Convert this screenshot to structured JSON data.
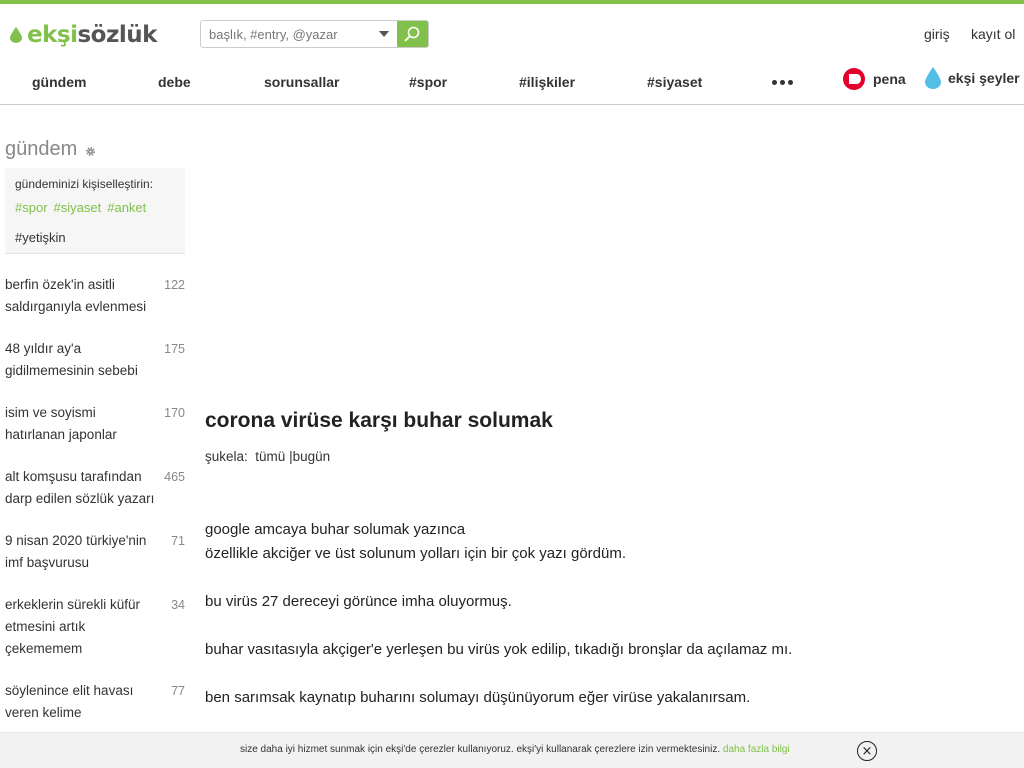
{
  "brand": {
    "logo_part1": "ekşi",
    "logo_part2": "sözlük",
    "accent_color": "#81c14b"
  },
  "search": {
    "placeholder": "başlık, #entry, @yazar"
  },
  "auth": {
    "login": "giriş",
    "register": "kayıt ol"
  },
  "nav": {
    "items": [
      "gündem",
      "debe",
      "sorunsallar",
      "#spor",
      "#ilişkiler",
      "#siyaset"
    ],
    "more_icon": "ellipsis-icon",
    "pena": "pena",
    "seyler": "ekşi şeyler"
  },
  "sidebar": {
    "title": "gündem",
    "personalize": {
      "title": "gündeminizi kişiselleştirin:",
      "tags": [
        "#spor",
        "#siyaset",
        "#anket"
      ],
      "adult": "#yetişkin"
    },
    "topics": [
      {
        "title": "berfin özek'in asitli saldırganıyla evlenmesi",
        "count": "122"
      },
      {
        "title": "48 yıldır ay'a gidilmemesinin sebebi",
        "count": "175"
      },
      {
        "title": "isim ve soyismi hatırlanan japonlar",
        "count": "170"
      },
      {
        "title": "alt komşusu tarafından darp edilen sözlük yazarı",
        "count": "465"
      },
      {
        "title": "9 nisan 2020 türkiye'nin imf başvurusu",
        "count": "71"
      },
      {
        "title": "erkeklerin sürekli küfür etmesini artık çekememem",
        "count": "34"
      },
      {
        "title": "söylenince elit havası veren kelime",
        "count": "77"
      }
    ]
  },
  "entry": {
    "title": "corona virüse karşı buhar solumak",
    "sukela_label": "şukela:",
    "sukela_all": "tümü",
    "sukela_sep": "|",
    "sukela_today": "bugün",
    "lines": [
      "google amcaya buhar solumak yazınca",
      "özellikle akciğer ve üst solunum yolları için bir çok yazı gördüm.",
      "bu virüs 27 dereceyi görünce imha oluyormuş.",
      "buhar vasıtasıyla akçiger'e yerleşen bu virüs yok edilip, tıkadığı bronşlar da açılamaz mı.",
      "ben sarımsak kaynatıp buharını solumayı düşünüyorum eğer virüse yakalanırsam."
    ]
  },
  "cookie": {
    "text": "size daha iyi hizmet sunmak için ekşi'de çerezler kullanıyoruz. ekşi'yi kullanarak çerezlere izin vermektesiniz.",
    "link": "daha fazla bilgi",
    "close_symbol": "×"
  }
}
